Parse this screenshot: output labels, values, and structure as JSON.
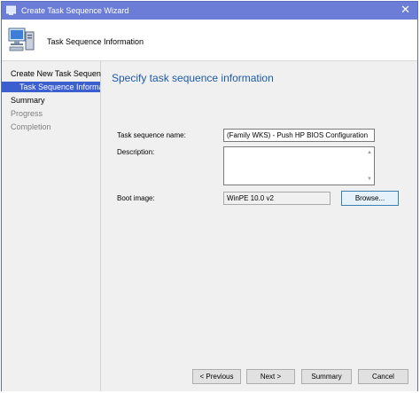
{
  "window": {
    "title": "Create Task Sequence Wizard",
    "close_glyph": "✕"
  },
  "header": {
    "title": "Task Sequence Information"
  },
  "sidebar": {
    "items": [
      {
        "label": "Create New Task Sequence"
      },
      {
        "label": "Task Sequence Information"
      },
      {
        "label": "Summary"
      },
      {
        "label": "Progress"
      },
      {
        "label": "Completion"
      }
    ]
  },
  "main": {
    "heading": "Specify task sequence information",
    "name_label": "Task sequence name:",
    "name_value": "(Family WKS) - Push HP BIOS Configuration",
    "description_label": "Description:",
    "description_value": "",
    "boot_label": "Boot image:",
    "boot_value": "WinPE 10.0 v2",
    "browse_label": "Browse..."
  },
  "footer": {
    "previous_label": "< Previous",
    "next_label": "Next >",
    "summary_label": "Summary",
    "cancel_label": "Cancel"
  },
  "colors": {
    "titlebar": "#6b7dd6",
    "selected_nav": "#3c5fd0",
    "heading": "#1e5aa8"
  }
}
